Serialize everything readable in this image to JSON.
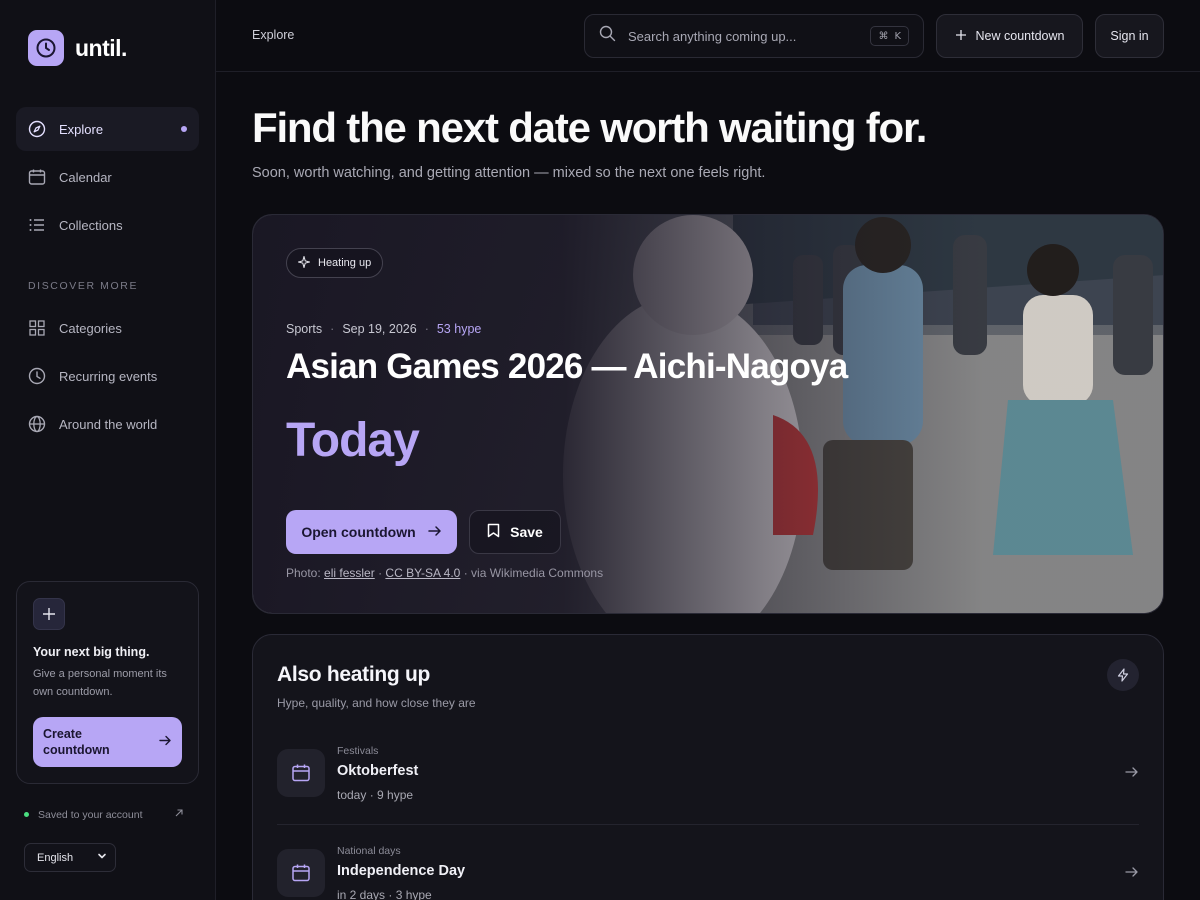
{
  "app": {
    "name": "until."
  },
  "sidebar": {
    "nav": [
      {
        "label": "Explore",
        "icon": "compass-icon",
        "active": true
      },
      {
        "label": "Calendar",
        "icon": "calendar-icon"
      },
      {
        "label": "Collections",
        "icon": "list-icon"
      }
    ],
    "section_label": "DISCOVER MORE",
    "discover": [
      {
        "label": "Categories",
        "icon": "grid-icon"
      },
      {
        "label": "Recurring events",
        "icon": "clock-icon"
      },
      {
        "label": "Around the world",
        "icon": "globe-icon"
      }
    ],
    "promo": {
      "title": "Your next big thing.",
      "text": "Give a personal moment its own countdown.",
      "button_label": "Create countdown"
    },
    "saved_label": "Saved to your account",
    "language": "English"
  },
  "topbar": {
    "breadcrumb": "Explore",
    "search_placeholder": "Search anything coming up...",
    "shortcut_mod": "⌘",
    "shortcut_key": "K",
    "new_label": "New countdown",
    "sign_in_label": "Sign in"
  },
  "page": {
    "title": "Find the next date worth waiting for.",
    "subtitle": "Soon, worth watching, and getting attention — mixed so the next one feels right."
  },
  "hero": {
    "badge": "Heating up",
    "category": "Sports",
    "date": "Sep 19, 2026",
    "hype": "53 hype",
    "title": "Asian Games 2026 — Aichi-Nagoya",
    "when": "Today",
    "open_label": "Open countdown",
    "save_label": "Save",
    "credit_prefix": "Photo:",
    "credit_author": "eli fessler",
    "credit_sep": "·",
    "credit_license": "CC BY-SA 4.0",
    "credit_source": "· via Wikimedia Commons"
  },
  "also": {
    "title": "Also heating up",
    "subtitle": "Hype, quality, and how close they are",
    "items": [
      {
        "category": "Festivals",
        "name": "Oktoberfest",
        "info": "today · 9 hype"
      },
      {
        "category": "National days",
        "name": "Independence Day",
        "info": "in 2 days · 3 hype"
      }
    ]
  },
  "colors": {
    "accent": "#b7a6f5",
    "background": "#0c0c11",
    "status_green": "#4ade80"
  }
}
